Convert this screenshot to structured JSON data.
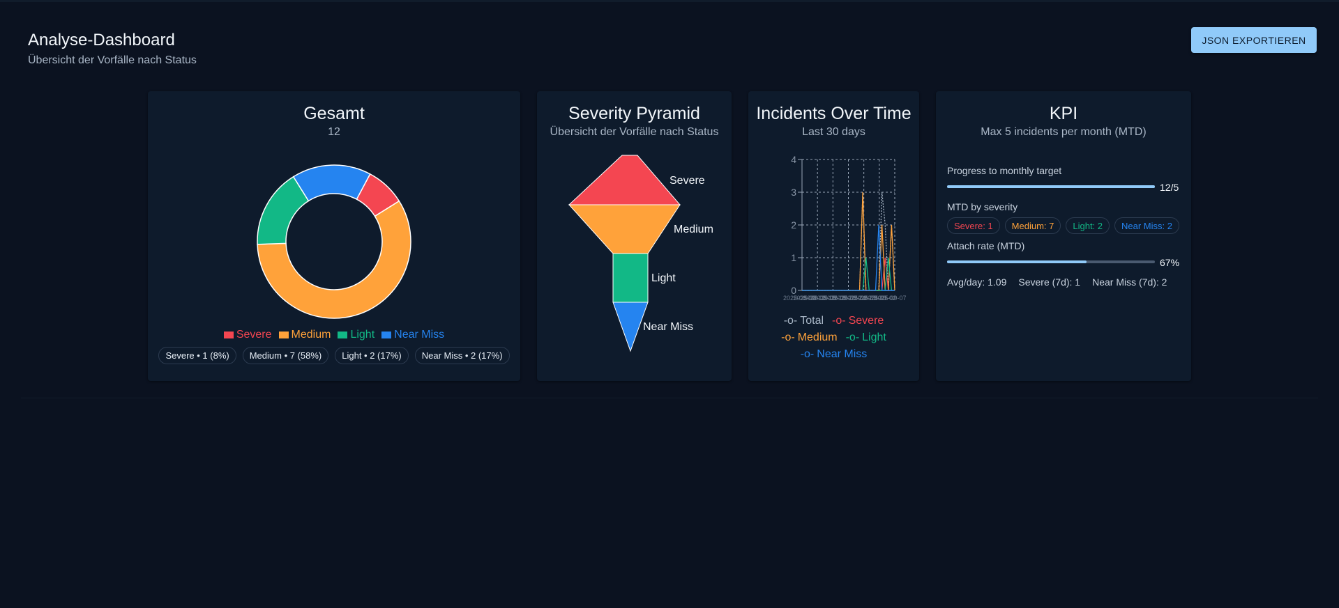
{
  "header": {
    "title": "Analyse-Dashboard",
    "subtitle": "Übersicht der Vorfälle nach Status",
    "export_label": "JSON EXPORTIEREN"
  },
  "colors": {
    "severe": "#f44651",
    "medium": "#ffa23a",
    "light": "#12b886",
    "near_miss": "#2584f0",
    "total": "#aab8c8",
    "accent": "#90caf9"
  },
  "total_card": {
    "title": "Gesamt",
    "count": "12",
    "legend": [
      "Severe",
      "Medium",
      "Light",
      "Near Miss"
    ],
    "chips": [
      "Severe • 1 (8%)",
      "Medium • 7 (58%)",
      "Light • 2 (17%)",
      "Near Miss • 2 (17%)"
    ]
  },
  "pyramid_card": {
    "title": "Severity Pyramid",
    "subtitle": "Übersicht der Vorfälle nach Status",
    "labels": [
      "Severe",
      "Medium",
      "Light",
      "Near Miss"
    ]
  },
  "time_card": {
    "title": "Incidents Over Time",
    "subtitle": "Last 30 days",
    "legend": [
      "Total",
      "Severe",
      "Medium",
      "Light",
      "Near Miss"
    ]
  },
  "kpi_card": {
    "title": "KPI",
    "subtitle": "Max 5 incidents per month (MTD)",
    "progress_label": "Progress to monthly target",
    "progress_value": "12/5",
    "progress_fraction": 1.0,
    "mtd_label": "MTD by severity",
    "mtd_chips": [
      "Severe: 1",
      "Medium: 7",
      "Light: 2",
      "Near Miss: 2"
    ],
    "attach_label": "Attach rate (MTD)",
    "attach_value": "67%",
    "attach_fraction": 0.67,
    "stats": [
      "Avg/day: 1.09",
      "Severe (7d): 1",
      "Near Miss (7d): 2"
    ]
  },
  "chart_data": [
    {
      "type": "pie",
      "variant": "donut",
      "categories": [
        "Severe",
        "Medium",
        "Light",
        "Near Miss"
      ],
      "values": [
        1,
        7,
        2,
        2
      ],
      "title": "Gesamt"
    },
    {
      "type": "funnel",
      "categories": [
        "Severe",
        "Medium",
        "Light",
        "Near Miss"
      ],
      "title": "Severity Pyramid"
    },
    {
      "type": "line",
      "title": "Incidents Over Time",
      "ylim": [
        0,
        4
      ],
      "yticks": [
        "0",
        "1",
        "2",
        "3",
        "4"
      ],
      "xticks": [
        "2025-08-09",
        "2025-08-12",
        "2025-08-15",
        "2025-08-18",
        "2025-08-21",
        "2025-08-24",
        "2025-08-27",
        "2025-08-30",
        "2025-09-02",
        "2025-09-07"
      ],
      "grid": true,
      "x": [
        "2025-08-09",
        "2025-08-26",
        "2025-08-27",
        "2025-08-28",
        "2025-08-29",
        "2025-08-30",
        "2025-08-31",
        "2025-09-01",
        "2025-09-02",
        "2025-09-03",
        "2025-09-04",
        "2025-09-05",
        "2025-09-06",
        "2025-09-07"
      ],
      "series": [
        {
          "name": "Total",
          "values": [
            0,
            0,
            0,
            3,
            0,
            0,
            0,
            0,
            0,
            3,
            2,
            0,
            2,
            0
          ]
        },
        {
          "name": "Severe",
          "values": [
            0,
            0,
            0,
            0,
            0,
            0,
            0,
            0,
            0,
            0,
            1,
            0,
            0,
            0
          ]
        },
        {
          "name": "Medium",
          "values": [
            0,
            0,
            0,
            3,
            0,
            0,
            0,
            0,
            0,
            2,
            0,
            0,
            2,
            0
          ]
        },
        {
          "name": "Light",
          "values": [
            0,
            0,
            0,
            0,
            1,
            0,
            0,
            0,
            0,
            0,
            0,
            1,
            0,
            0
          ]
        },
        {
          "name": "Near Miss",
          "values": [
            0,
            0,
            0,
            0,
            0,
            0,
            0,
            0,
            2,
            0,
            0,
            0,
            0,
            0
          ]
        }
      ]
    }
  ]
}
